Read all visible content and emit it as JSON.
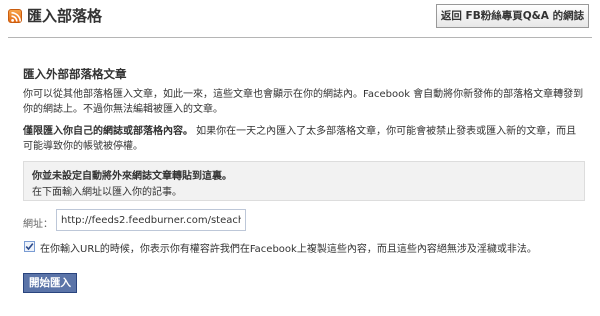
{
  "header": {
    "icon": "rss-feed-icon",
    "title": "匯入部落格",
    "back_button_label": "返回 FB粉絲專頁Q&A 的網誌"
  },
  "import_section": {
    "heading": "匯入外部部落格文章",
    "description": "你可以從其他部落格匯入文章，如此一來，這些文章也會顯示在你的網誌內。Facebook 會自動將你新發佈的部落格文章轉發到你的網誌上。不過你無法編輯被匯入的文章。",
    "notice_bold": "僅限匯入你自己的網誌或部落格內容。",
    "notice_rest": " 如果你在一天之內匯入了太多部落格文章，你可能會被禁止發表或匯入新的文章，而且可能導致你的帳號被停權。"
  },
  "warning_box": {
    "title": "你並未設定自動將外來網誌文章轉貼到這裏。",
    "subtitle": "在下面輸入網址以匯入你的記事。"
  },
  "url_field": {
    "label": "網址：",
    "value": "http://feeds2.feedburner.com/steach"
  },
  "terms": {
    "checked": true,
    "text": "在你輸入URL的時候，你表示你有權容許我們在Facebook上複製這些內容，而且這些內容絕無涉及淫穢或非法。"
  },
  "start_button_label": "開始匯入",
  "colors": {
    "button_primary": "#5b74a8",
    "divider": "#b5b5b5",
    "warning_bg": "#f2f2f2"
  }
}
